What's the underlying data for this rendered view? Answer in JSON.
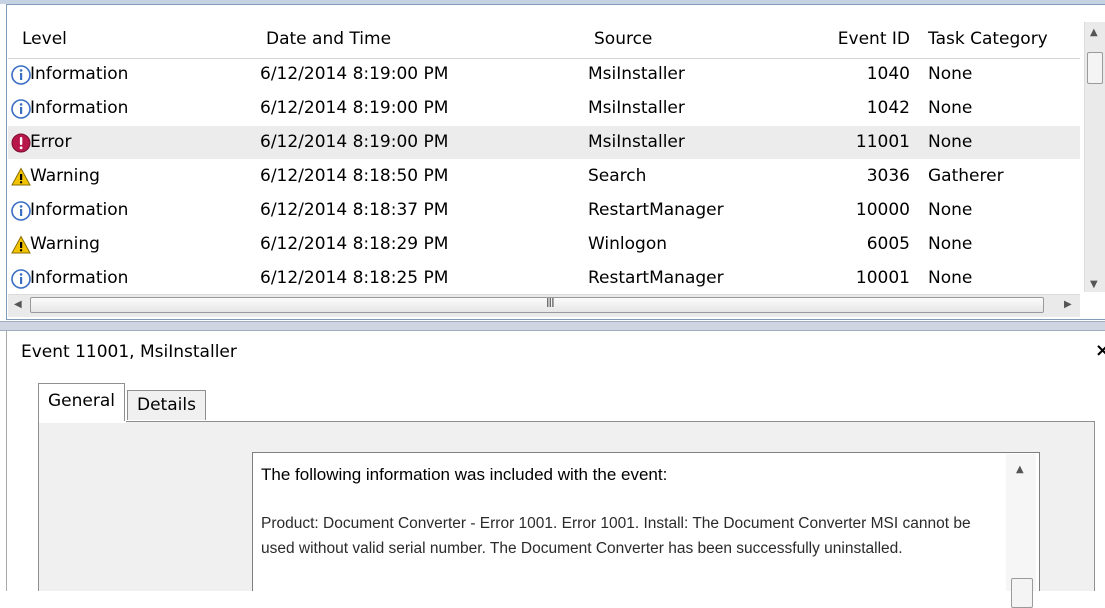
{
  "columns": {
    "level": "Level",
    "date": "Date and Time",
    "source": "Source",
    "event_id": "Event ID",
    "category": "Task Category"
  },
  "events": [
    {
      "level": "Information",
      "icon": "info-icon",
      "date": "6/12/2014 8:19:00 PM",
      "source": "MsiInstaller",
      "event_id": "1040",
      "category": "None"
    },
    {
      "level": "Information",
      "icon": "info-icon",
      "date": "6/12/2014 8:19:00 PM",
      "source": "MsiInstaller",
      "event_id": "1042",
      "category": "None"
    },
    {
      "level": "Error",
      "icon": "error-icon",
      "date": "6/12/2014 8:19:00 PM",
      "source": "MsiInstaller",
      "event_id": "11001",
      "category": "None",
      "selected": true
    },
    {
      "level": "Warning",
      "icon": "warning-icon",
      "date": "6/12/2014 8:18:50 PM",
      "source": "Search",
      "event_id": "3036",
      "category": "Gatherer"
    },
    {
      "level": "Information",
      "icon": "info-icon",
      "date": "6/12/2014 8:18:37 PM",
      "source": "RestartManager",
      "event_id": "10000",
      "category": "None"
    },
    {
      "level": "Warning",
      "icon": "warning-icon",
      "date": "6/12/2014 8:18:29 PM",
      "source": "Winlogon",
      "event_id": "6005",
      "category": "None"
    },
    {
      "level": "Information",
      "icon": "info-icon",
      "date": "6/12/2014 8:18:25 PM",
      "source": "RestartManager",
      "event_id": "10001",
      "category": "None"
    }
  ],
  "detail": {
    "title": "Event 11001, MsiInstaller",
    "close_label": "×",
    "tabs": [
      "General",
      "Details"
    ],
    "active_tab": "General",
    "message_heading": "The following information was included with the event:",
    "message_body": "Product: Document Converter - Error 1001. Error 1001. Install: The Document Converter MSI cannot be used without valid serial number. The Document Converter has been successfully uninstalled."
  },
  "scrollbar": {
    "grip": "III"
  },
  "colors": {
    "info": "#3a6fc4",
    "error": "#b8174a",
    "warning": "#f2c400",
    "selected_row": "#ececec"
  }
}
